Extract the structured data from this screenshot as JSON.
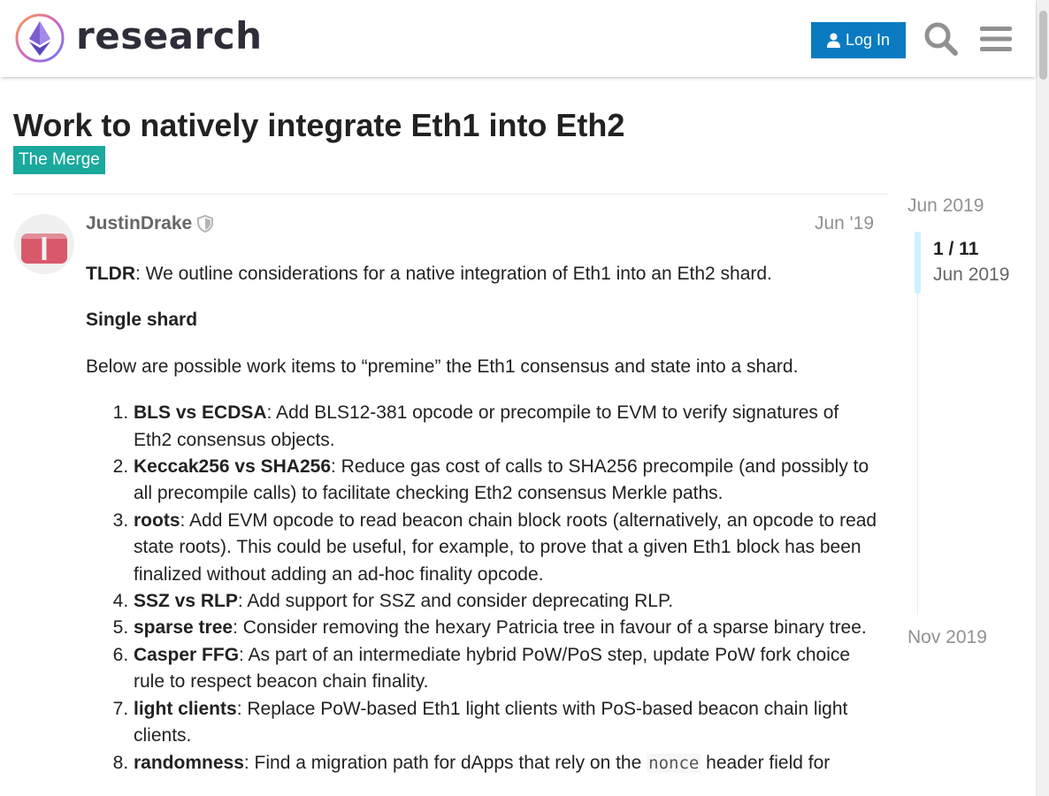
{
  "header": {
    "site_name": "research",
    "login_label": "Log In",
    "search_icon": "search-icon",
    "menu_icon": "hamburger-menu-icon"
  },
  "topic": {
    "title": "Work to natively integrate Eth1 into Eth2",
    "category": "The Merge",
    "category_color": "#1aa99c"
  },
  "post": {
    "username": "JustinDrake",
    "date": "Jun '19",
    "tldr_label": "TLDR",
    "tldr_text": ": We outline considerations for a native integration of Eth1 into an Eth2 shard.",
    "section_heading": "Single shard",
    "intro": "Below are possible work items to “premine” the Eth1 consensus and state into a shard.",
    "items": [
      {
        "term": "BLS vs ECDSA",
        "text": ": Add BLS12-381 opcode or precompile to EVM to verify signatures of Eth2 consensus objects."
      },
      {
        "term": "Keccak256 vs SHA256",
        "text": ": Reduce gas cost of calls to SHA256 precompile (and possibly to all precompile calls) to facilitate checking Eth2 consensus Merkle paths."
      },
      {
        "term": "roots",
        "text": ": Add EVM opcode to read beacon chain block roots (alternatively, an opcode to read state roots). This could be useful, for example, to prove that a given Eth1 block has been finalized without adding an ad-hoc finality opcode."
      },
      {
        "term": "SSZ vs RLP",
        "text": ": Add support for SSZ and consider deprecating RLP."
      },
      {
        "term": "sparse tree",
        "text": ": Consider removing the hexary Patricia tree in favour of a sparse binary tree."
      },
      {
        "term": "Casper FFG",
        "text": ": As part of an intermediate hybrid PoW/PoS step, update PoW fork choice rule to respect beacon chain finality."
      },
      {
        "term": "light clients",
        "text": ": Replace PoW-based Eth1 light clients with PoS-based beacon chain light clients."
      },
      {
        "term": "randomness",
        "text": ": Find a migration path for dApps that rely on the ",
        "code": "nonce",
        "text_after": " header field for"
      }
    ]
  },
  "timeline": {
    "start_date": "Jun 2019",
    "counter": "1 / 11",
    "counter_date": "Jun 2019",
    "end_date": "Nov 2019"
  },
  "colors": {
    "accent": "#0a7bc1",
    "category": "#1aa99c",
    "avatar": "#d9596b"
  }
}
